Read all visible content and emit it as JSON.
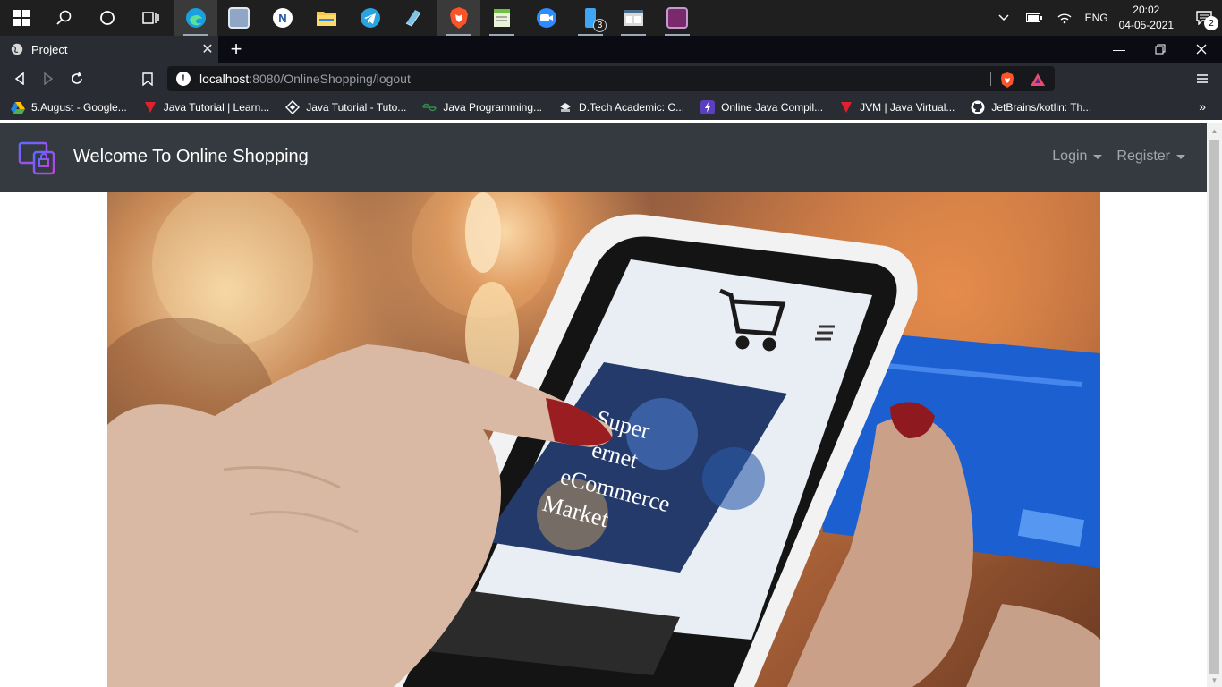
{
  "taskbar": {
    "apps": [
      {
        "name": "start-icon"
      },
      {
        "name": "search-icon"
      },
      {
        "name": "cortana-icon"
      },
      {
        "name": "task-view-icon"
      },
      {
        "name": "edge-icon",
        "color": "#1aa0e0"
      },
      {
        "name": "photos-icon",
        "color": "#8fa7c4"
      },
      {
        "name": "app-n-icon",
        "color": "#ffffff"
      },
      {
        "name": "file-explorer-icon",
        "color": "#f2c84b"
      },
      {
        "name": "telegram-icon",
        "color": "#2aa3df"
      },
      {
        "name": "app-blue-icon",
        "color": "#7fc3e8"
      },
      {
        "name": "brave-icon",
        "color": "#fb542b"
      },
      {
        "name": "notepad-icon",
        "color": "#6fbf45"
      },
      {
        "name": "zoom-icon",
        "color": "#2d8cff"
      },
      {
        "name": "phone-app-icon",
        "color": "#3ea6f2",
        "badge": "3"
      },
      {
        "name": "window-app-icon",
        "color": "#d9d9d9"
      },
      {
        "name": "game-icon",
        "color": "#7a2a6b"
      }
    ],
    "tray": {
      "language": "ENG",
      "time": "20:02",
      "date": "04-05-2021",
      "notifications": "2"
    }
  },
  "browser": {
    "tab_title": "Project",
    "url_host": "localhost",
    "url_rest": ":8080/OnlineShopping/logout",
    "bookmarks": [
      {
        "label": "5.August - Google...",
        "icon": "google-drive-icon"
      },
      {
        "label": "Java Tutorial | Learn...",
        "icon": "java-red-icon"
      },
      {
        "label": "Java Tutorial - Tuto...",
        "icon": "tutorialspoint-icon"
      },
      {
        "label": "Java Programming...",
        "icon": "gfg-icon"
      },
      {
        "label": "D.Tech Academic: C...",
        "icon": "dtech-icon"
      },
      {
        "label": "Online Java Compil...",
        "icon": "compiler-icon"
      },
      {
        "label": "JVM | Java Virtual...",
        "icon": "java-red-icon"
      },
      {
        "label": "JetBrains/kotlin: Th...",
        "icon": "github-icon"
      }
    ]
  },
  "page": {
    "brand": "Welcome To Online Shopping",
    "nav": {
      "login": "Login",
      "register": "Register"
    },
    "hero_image": "smartphone-shopping-photo"
  },
  "colors": {
    "navbar_bg": "#343a40",
    "browser_chrome": "#2a2c33",
    "taskbar": "#1f1f1f"
  }
}
